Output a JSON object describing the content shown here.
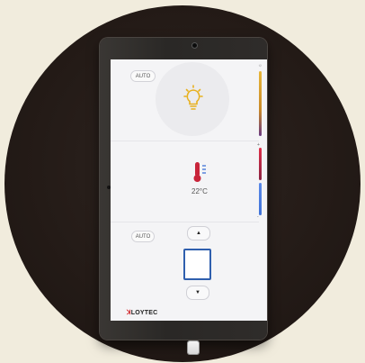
{
  "scene": {
    "background_color": "#f1ecdd",
    "disc_color": "#241b17",
    "device_frame_color": "#2f2c2a"
  },
  "lighting_section": {
    "mode_button": "AUTO",
    "icon": "lightbulb-icon",
    "slider_color_top": "#e0b13a",
    "slider_color_bottom": "#6a3a82"
  },
  "temperature_section": {
    "icon": "thermometer-icon",
    "temperature": "22°C",
    "slider_color_top": "#c8243a",
    "slider_color_bottom": "#3f72d8"
  },
  "blinds_section": {
    "mode_button": "AUTO",
    "up_label": "▲",
    "down_label": "▼",
    "accent_color": "#2f5fae"
  },
  "footer": {
    "brand_mark": "ꓘ",
    "brand_name": "LOYTEC"
  }
}
